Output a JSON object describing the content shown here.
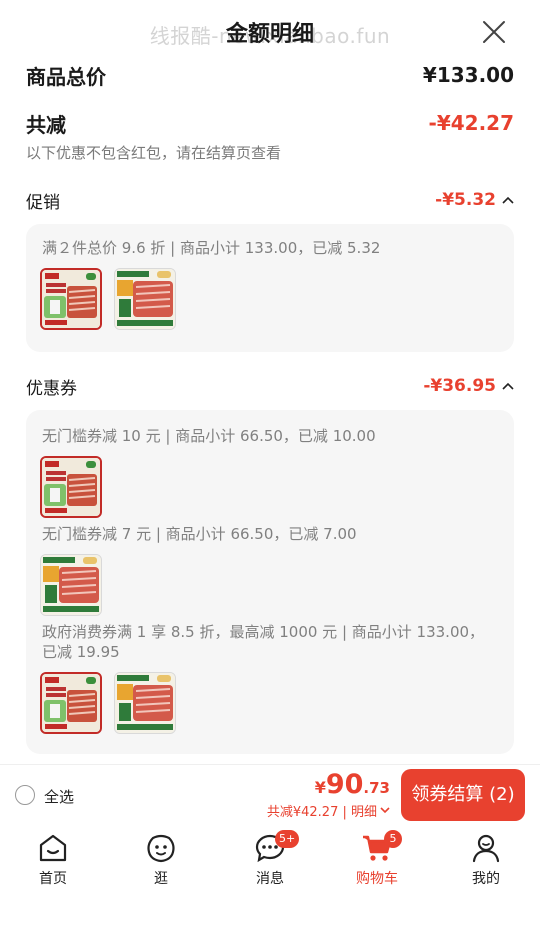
{
  "header": {
    "title": "金额明细",
    "watermark": "线报酷-new.xianbao.fun"
  },
  "summary": {
    "total_label": "商品总价",
    "total_value": "¥133.00",
    "reduce_label": "共减",
    "reduce_value": "-¥42.27",
    "note": "以下优惠不包含红包，请在结算页查看"
  },
  "promo": {
    "label": "促销",
    "value": "-¥5.32",
    "lines": [
      "满２件总价 9.6 折 | 商品小计 133.00，已减 5.32"
    ]
  },
  "coupon": {
    "label": "优惠券",
    "value": "-¥36.95",
    "lines": [
      "无门槛券减 10 元 | 商品小计 66.50，已减 10.00",
      "无门槛券减 7 元 | 商品小计 66.50，已减 7.00",
      "政府消费券满 1 享 8.5 折，最高减 1000 元 | 商品小计 133.00，已减 19.95"
    ]
  },
  "bottom": {
    "select_all": "全选",
    "price_yen": "¥",
    "price_int": "90",
    "price_dec": ".73",
    "price_sub": "共减¥42.27 | 明细",
    "checkout": "领券结算 (2)"
  },
  "tabs": [
    {
      "label": "首页",
      "icon": "home-icon"
    },
    {
      "label": "逛",
      "icon": "browse-icon"
    },
    {
      "label": "消息",
      "icon": "message-icon",
      "badge": "5+"
    },
    {
      "label": "购物车",
      "icon": "cart-icon",
      "badge": "5",
      "active": true
    },
    {
      "label": "我的",
      "icon": "profile-icon"
    }
  ],
  "colors": {
    "accent": "#e8412f",
    "text": "#1a1a1a",
    "muted": "#7a7a7a",
    "card_bg": "#f6f6f6"
  }
}
